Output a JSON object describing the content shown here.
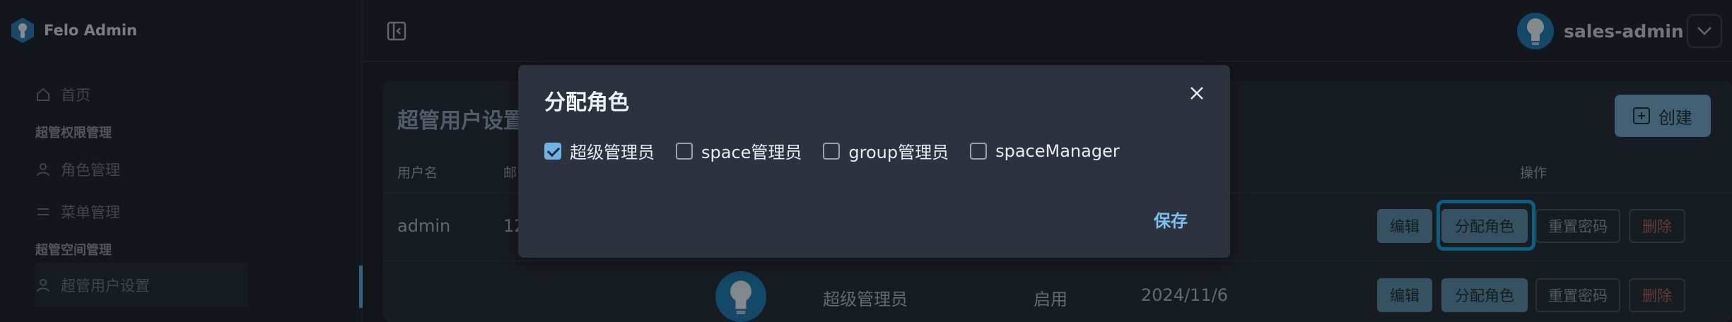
{
  "app": {
    "name": "Felo Admin"
  },
  "user": {
    "name": "sales-admin"
  },
  "sidebar": {
    "items": [
      {
        "label": "首页"
      },
      {
        "group": "超管权限管理"
      },
      {
        "label": "角色管理"
      },
      {
        "label": "菜单管理"
      },
      {
        "group": "超管空间管理"
      },
      {
        "label": "超管用户设置"
      }
    ]
  },
  "main": {
    "title": "超管用户设置",
    "create_label": "创建",
    "columns": {
      "username": "用户名",
      "email": "邮",
      "actions": "操作"
    },
    "rows": [
      {
        "username": "admin",
        "email": "12"
      },
      {
        "role": "超级管理员",
        "status": "启用",
        "date": "2024/11/6"
      }
    ],
    "actions": {
      "edit": "编辑",
      "assign": "分配角色",
      "reset": "重置密码",
      "delete": "删除"
    }
  },
  "modal": {
    "title": "分配角色",
    "options": [
      {
        "label": "超级管理员",
        "checked": true
      },
      {
        "label": "space管理员",
        "checked": false
      },
      {
        "label": "group管理员",
        "checked": false
      },
      {
        "label": "spaceManager",
        "checked": false
      }
    ],
    "save_label": "保存"
  },
  "colors": {
    "accent": "#12a3e3",
    "primary_button": "#5c8aa6",
    "modal_bg": "#2c333e"
  }
}
